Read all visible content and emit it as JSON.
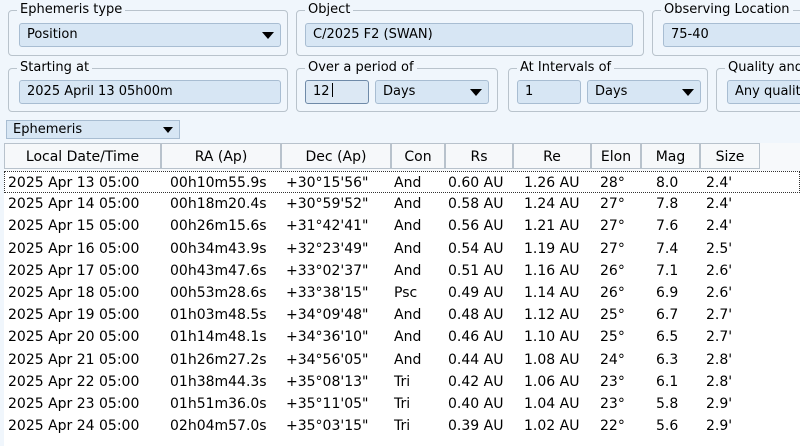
{
  "filters": {
    "ephemeris_type": {
      "title": "Ephemeris type",
      "value": "Position"
    },
    "object": {
      "title": "Object",
      "value": "C/2025 F2 (SWAN)"
    },
    "location": {
      "title": "Observing Location",
      "value": "75-40"
    },
    "starting": {
      "title": "Starting at",
      "value": "2025 April 13  05h00m"
    },
    "period": {
      "title": "Over a period of",
      "value": "12",
      "unit": "Days"
    },
    "interval": {
      "title": "At Intervals of",
      "value": "1",
      "unit": "Days"
    },
    "quality": {
      "title": "Quality and",
      "value": "Any qualit"
    }
  },
  "view_selector": {
    "value": "Ephemeris"
  },
  "table": {
    "columns": [
      "Local Date/Time",
      "RA (Ap)",
      "Dec (Ap)",
      "Con",
      "Rs",
      "Re",
      "Elon",
      "Mag",
      "Size"
    ],
    "rows": [
      [
        "2025 Apr 13 05:00",
        "00h10m55.9s",
        "+30°15'56\"",
        "And",
        "0.60 AU",
        "1.26 AU",
        "28°",
        "8.0",
        "2.4'"
      ],
      [
        "2025 Apr 14 05:00",
        "00h18m20.4s",
        "+30°59'52\"",
        "And",
        "0.58 AU",
        "1.24 AU",
        "27°",
        "7.8",
        "2.4'"
      ],
      [
        "2025 Apr 15 05:00",
        "00h26m15.6s",
        "+31°42'41\"",
        "And",
        "0.56 AU",
        "1.21 AU",
        "27°",
        "7.6",
        "2.4'"
      ],
      [
        "2025 Apr 16 05:00",
        "00h34m43.9s",
        "+32°23'49\"",
        "And",
        "0.54 AU",
        "1.19 AU",
        "27°",
        "7.4",
        "2.5'"
      ],
      [
        "2025 Apr 17 05:00",
        "00h43m47.6s",
        "+33°02'37\"",
        "And",
        "0.51 AU",
        "1.16 AU",
        "26°",
        "7.1",
        "2.6'"
      ],
      [
        "2025 Apr 18 05:00",
        "00h53m28.6s",
        "+33°38'15\"",
        "Psc",
        "0.49 AU",
        "1.14 AU",
        "26°",
        "6.9",
        "2.6'"
      ],
      [
        "2025 Apr 19 05:00",
        "01h03m48.5s",
        "+34°09'48\"",
        "And",
        "0.48 AU",
        "1.12 AU",
        "25°",
        "6.7",
        "2.7'"
      ],
      [
        "2025 Apr 20 05:00",
        "01h14m48.1s",
        "+34°36'10\"",
        "And",
        "0.46 AU",
        "1.10 AU",
        "25°",
        "6.5",
        "2.7'"
      ],
      [
        "2025 Apr 21 05:00",
        "01h26m27.2s",
        "+34°56'05\"",
        "And",
        "0.44 AU",
        "1.08 AU",
        "24°",
        "6.3",
        "2.8'"
      ],
      [
        "2025 Apr 22 05:00",
        "01h38m44.3s",
        "+35°08'13\"",
        "Tri",
        "0.42 AU",
        "1.06 AU",
        "23°",
        "6.1",
        "2.8'"
      ],
      [
        "2025 Apr 23 05:00",
        "01h51m36.0s",
        "+35°11'05\"",
        "Tri",
        "0.40 AU",
        "1.04 AU",
        "23°",
        "5.8",
        "2.9'"
      ],
      [
        "2025 Apr 24 05:00",
        "02h04m57.0s",
        "+35°03'15\"",
        "Tri",
        "0.39 AU",
        "1.02 AU",
        "22°",
        "5.6",
        "2.9'"
      ]
    ]
  }
}
